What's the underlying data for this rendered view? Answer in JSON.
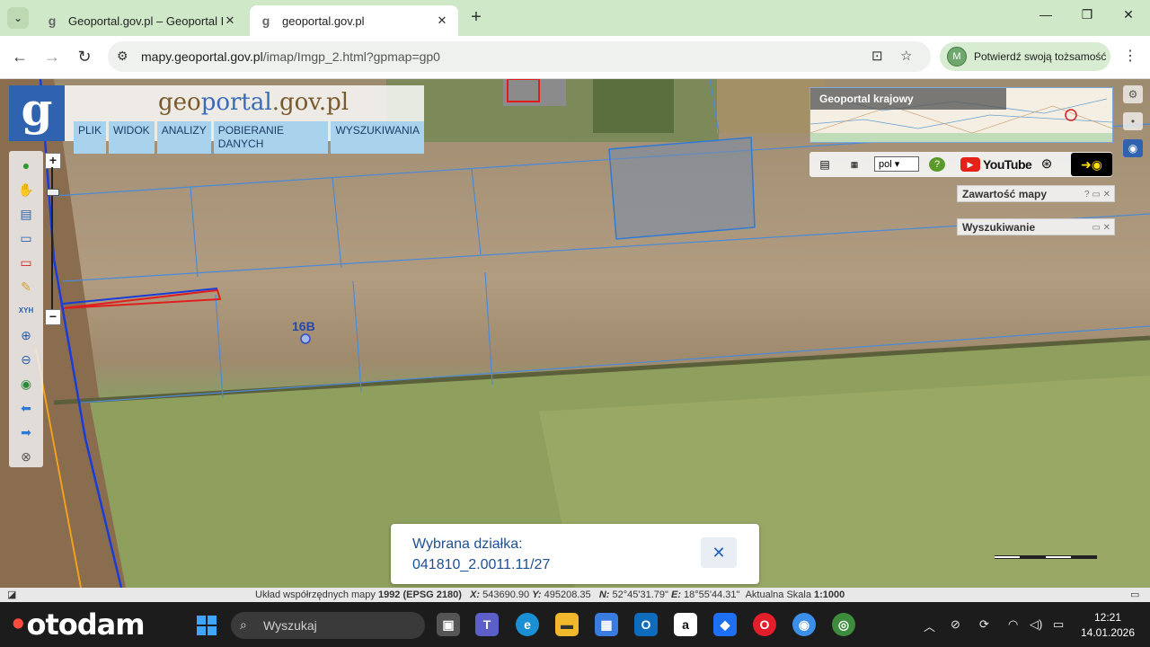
{
  "browser": {
    "tabs": [
      {
        "title": "Geoportal.gov.pl – Geoportal In",
        "favicon": "g"
      },
      {
        "title": "geoportal.gov.pl",
        "favicon": "g"
      }
    ],
    "address": {
      "domain": "mapy.geoportal.gov.pl",
      "path": "/imap/Imgp_2.html?gpmap=gp0"
    },
    "profile_label": "Potwierdź swoją tożsamość",
    "profile_initial": "M"
  },
  "geoportal": {
    "logo_letter": "g",
    "logo_text_a": "geo",
    "logo_text_b": "portal",
    "logo_text_c": ".gov.pl",
    "menu": [
      "PLIK",
      "WIDOK",
      "ANALIZY",
      "POBIERANIE DANYCH",
      "WYSZUKIWANIA"
    ],
    "minimap_title": "Geoportal krajowy",
    "language": "pol",
    "youtube_label": "YouTube",
    "panel_contents": "Zawartość mapy",
    "panel_search": "Wyszukiwanie",
    "parcel_label": "16B",
    "xyh_label": "XYH"
  },
  "popup": {
    "line1": "Wybrana działka:",
    "line2": "041810_2.0011.11/27"
  },
  "status": {
    "coord_label": "Układ współrzędnych mapy",
    "coord_system": "1992 (EPSG 2180)",
    "x_label": "X:",
    "x_value": "543690.90",
    "y_label": "Y:",
    "y_value": "495208.35",
    "n_label": "N:",
    "n_value": "52°45'31.79\"",
    "e_label": "E:",
    "e_value": "18°55'44.31\"",
    "scale_label": "Aktualna Skala",
    "scale_value": "1:1000"
  },
  "taskbar": {
    "brand": "otodam",
    "search_placeholder": "Wyszukaj",
    "time": "12:21",
    "date": "14.01.2026"
  },
  "colors": {
    "tabstrip": "#cfe8c8",
    "logo_blue": "#2f63b0",
    "menu_bg": "#a9d3ec",
    "popup_text": "#1f4f92",
    "parcel_line": "#4a8ad8"
  }
}
